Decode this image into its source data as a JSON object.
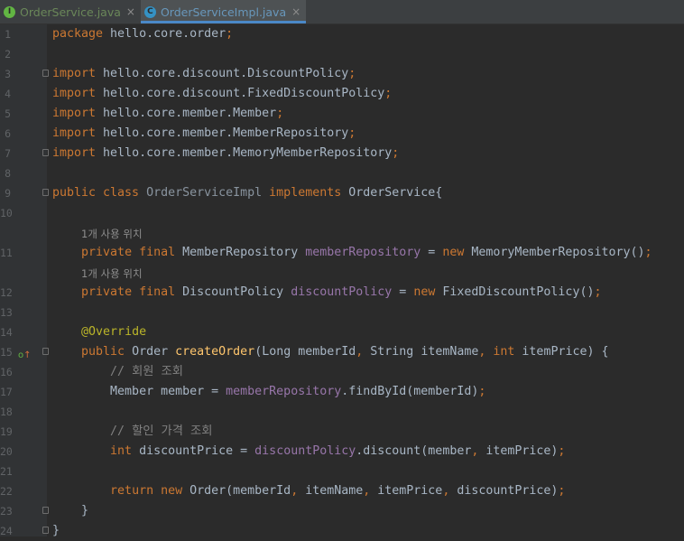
{
  "tabs": [
    {
      "name": "OrderService.java",
      "icon": "interface-icon",
      "icon_letter": "I",
      "active": false
    },
    {
      "name": "OrderServiceImpl.java",
      "icon": "class-icon",
      "icon_letter": "C",
      "active": true
    }
  ],
  "close_glyph": "×",
  "hints": {
    "usage_1": "1개 사용 위치",
    "usage_2": "1개 사용 위치"
  },
  "lines": [
    {
      "n": "1",
      "t": [
        [
          "kw",
          "package "
        ],
        [
          "",
          "hello.core.order"
        ],
        [
          "kw",
          ";"
        ]
      ]
    },
    {
      "n": "2",
      "t": []
    },
    {
      "n": "3",
      "t": [
        [
          "kw",
          "import "
        ],
        [
          "",
          "hello.core.discount.DiscountPolicy"
        ],
        [
          "kw",
          ";"
        ]
      ]
    },
    {
      "n": "4",
      "t": [
        [
          "kw",
          "import "
        ],
        [
          "",
          "hello.core.discount.FixedDiscountPolicy"
        ],
        [
          "kw",
          ";"
        ]
      ]
    },
    {
      "n": "5",
      "t": [
        [
          "kw",
          "import "
        ],
        [
          "",
          "hello.core.member.Member"
        ],
        [
          "kw",
          ";"
        ]
      ]
    },
    {
      "n": "6",
      "t": [
        [
          "kw",
          "import "
        ],
        [
          "",
          "hello.core.member.MemberRepository"
        ],
        [
          "kw",
          ";"
        ]
      ]
    },
    {
      "n": "7",
      "t": [
        [
          "kw",
          "import "
        ],
        [
          "",
          "hello.core.member.MemoryMemberRepository"
        ],
        [
          "kw",
          ";"
        ]
      ]
    },
    {
      "n": "8",
      "t": []
    },
    {
      "n": "9",
      "t": [
        [
          "kw",
          "public class "
        ],
        [
          "cls-gray",
          "OrderServiceImpl "
        ],
        [
          "kw",
          "implements "
        ],
        [
          "",
          "OrderService{"
        ]
      ]
    },
    {
      "n": "10",
      "t": []
    },
    {
      "n": "11",
      "t": [
        [
          "",
          "    "
        ],
        [
          "kw",
          "private final "
        ],
        [
          "",
          "MemberRepository "
        ],
        [
          "fld",
          "memberRepository"
        ],
        [
          "",
          " = "
        ],
        [
          "kw",
          "new "
        ],
        [
          "",
          "MemoryMemberRepository()"
        ],
        [
          "kw",
          ";"
        ]
      ]
    },
    {
      "n": "12",
      "t": [
        [
          "",
          "    "
        ],
        [
          "kw",
          "private final "
        ],
        [
          "",
          "DiscountPolicy "
        ],
        [
          "fld",
          "discountPolicy"
        ],
        [
          "",
          " = "
        ],
        [
          "kw",
          "new "
        ],
        [
          "",
          "FixedDiscountPolicy()"
        ],
        [
          "kw",
          ";"
        ]
      ]
    },
    {
      "n": "13",
      "t": []
    },
    {
      "n": "14",
      "t": [
        [
          "",
          "    "
        ],
        [
          "ann",
          "@Override"
        ]
      ]
    },
    {
      "n": "15",
      "t": [
        [
          "",
          "    "
        ],
        [
          "kw",
          "public "
        ],
        [
          "",
          "Order "
        ],
        [
          "fn",
          "createOrder"
        ],
        [
          "",
          "(Long memberId"
        ],
        [
          "kw",
          ", "
        ],
        [
          "",
          "String itemName"
        ],
        [
          "kw",
          ", int "
        ],
        [
          "",
          "itemPrice) {"
        ]
      ]
    },
    {
      "n": "16",
      "t": [
        [
          "",
          "        "
        ],
        [
          "cm",
          "// 회원 조회"
        ]
      ]
    },
    {
      "n": "17",
      "t": [
        [
          "",
          "        Member member = "
        ],
        [
          "fld",
          "memberRepository"
        ],
        [
          "",
          ".findById(memberId)"
        ],
        [
          "kw",
          ";"
        ]
      ]
    },
    {
      "n": "18",
      "t": []
    },
    {
      "n": "19",
      "t": [
        [
          "",
          "        "
        ],
        [
          "cm",
          "// 할인 가격 조회"
        ]
      ]
    },
    {
      "n": "20",
      "t": [
        [
          "",
          "        "
        ],
        [
          "kw",
          "int "
        ],
        [
          "",
          "discountPrice = "
        ],
        [
          "fld",
          "discountPolicy"
        ],
        [
          "",
          ".discount(member"
        ],
        [
          "kw",
          ", "
        ],
        [
          "",
          "itemPrice)"
        ],
        [
          "kw",
          ";"
        ]
      ]
    },
    {
      "n": "21",
      "t": []
    },
    {
      "n": "22",
      "t": [
        [
          "",
          "        "
        ],
        [
          "kw",
          "return new "
        ],
        [
          "",
          "Order(memberId"
        ],
        [
          "kw",
          ", "
        ],
        [
          "",
          "itemName"
        ],
        [
          "kw",
          ", "
        ],
        [
          "",
          "itemPrice"
        ],
        [
          "kw",
          ", "
        ],
        [
          "",
          "discountPrice)"
        ],
        [
          "kw",
          ";"
        ]
      ]
    },
    {
      "n": "23",
      "t": [
        [
          "",
          "    }"
        ]
      ]
    },
    {
      "n": "24",
      "t": [
        [
          "",
          "}"
        ]
      ]
    }
  ],
  "gutter_marker": {
    "line": "15",
    "label": "o",
    "arrow": "↑"
  },
  "colors": {
    "background": "#2b2b2b",
    "keyword": "#cc7832",
    "field": "#9876aa",
    "annotation": "#bbb529",
    "method": "#ffc66d",
    "comment": "#808080",
    "text": "#a9b7c6"
  }
}
